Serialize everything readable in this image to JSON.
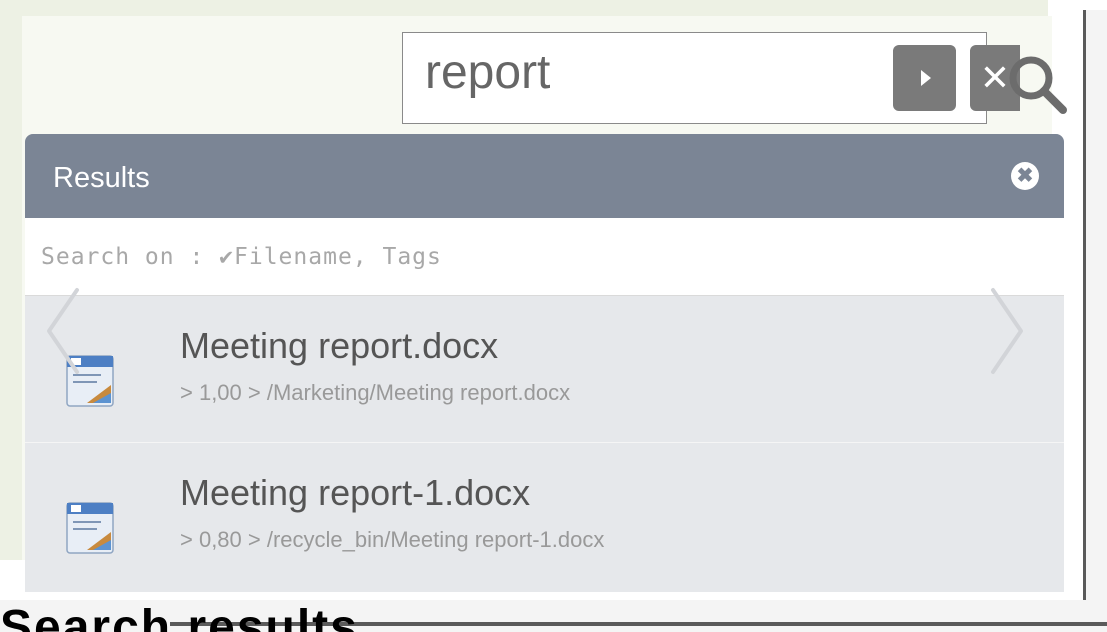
{
  "search": {
    "value": "report",
    "go_label": "",
    "clear_label": "✕"
  },
  "panel": {
    "title": "Results",
    "close_label": "✖",
    "search_on_text": "Search on : ✔Filename, Tags"
  },
  "results": [
    {
      "name": "Meeting report.docx",
      "meta": "> 1,00 > /Marketing/Meeting report.docx",
      "icon": "docx-file-icon"
    },
    {
      "name": "Meeting report-1.docx",
      "meta": "> 0,80 > /recycle_bin/Meeting report-1.docx",
      "icon": "docx-file-icon"
    }
  ],
  "background": {
    "cut_word": "Search results"
  },
  "colors": {
    "header": "#7b8595",
    "panel": "#e6e8eb",
    "button": "#7a7a7a"
  }
}
